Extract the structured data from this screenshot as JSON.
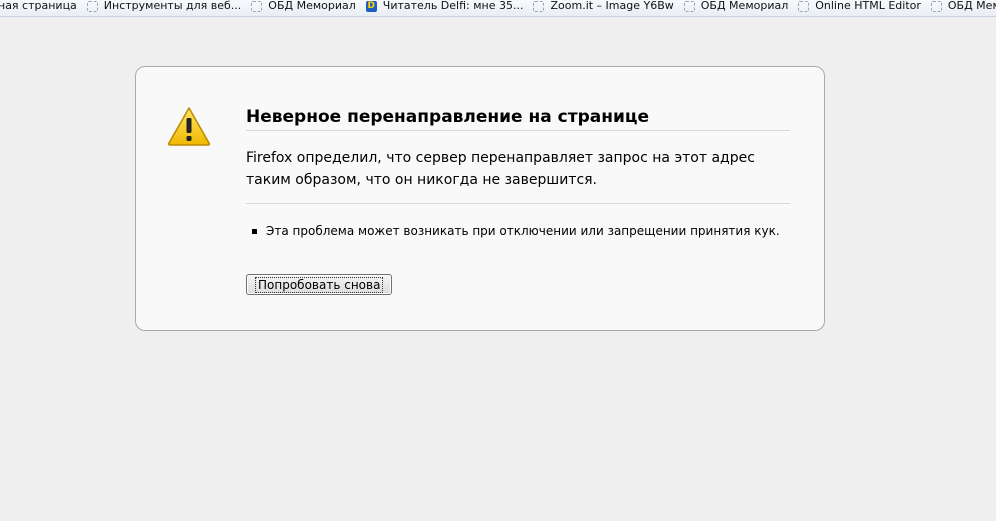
{
  "bookmarks": [
    {
      "label": "ная страница",
      "icon": "none"
    },
    {
      "label": "Инструменты для веб...",
      "icon": "blank-page-icon"
    },
    {
      "label": "ОБД Мемориал",
      "icon": "blank-page-icon"
    },
    {
      "label": "Читатель Delfi: мне 35...",
      "icon": "delfi-icon"
    },
    {
      "label": "Zoom.it – Image Y6Bw",
      "icon": "blank-page-icon"
    },
    {
      "label": "ОБД Мемориал",
      "icon": "blank-page-icon"
    },
    {
      "label": "Online HTML Editor",
      "icon": "blank-page-icon"
    },
    {
      "label": "ОБД Мемориа",
      "icon": "blank-page-icon"
    }
  ],
  "error": {
    "title": "Неверное перенаправление на странице",
    "description": "Firefox определил, что сервер перенаправляет запрос на этот адрес таким образом, что он никогда не завершится.",
    "bullet": "Эта проблема может возникать при отключении или запрещении принятия кук.",
    "retry_label": "Попробовать снова"
  },
  "colors": {
    "page_bg": "#efefef",
    "warning_yellow": "#f5c400"
  }
}
